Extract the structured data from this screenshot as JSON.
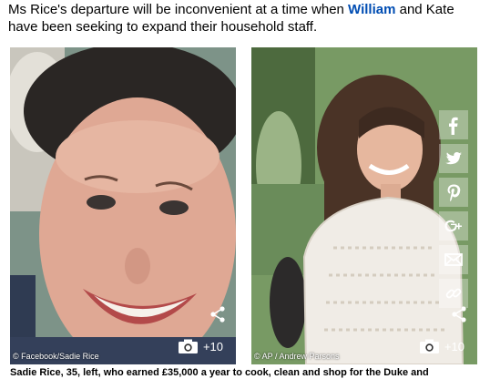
{
  "article": {
    "text_before": "Ms Rice's departure will be inconvenient at a time when ",
    "link_william": "William",
    "text_after": " and Kate have been seeking to expand their household staff."
  },
  "photos": [
    {
      "credit": "© Facebook/Sadie Rice",
      "gallery_count": "+10"
    },
    {
      "credit": "© AP / Andrew Parsons",
      "gallery_count": "+10"
    }
  ],
  "social_icons": [
    "facebook-icon",
    "twitter-icon",
    "pinterest-icon",
    "google-plus-icon",
    "email-icon",
    "link-icon"
  ],
  "caption": "Sadie Rice, 35, left, who earned £35,000 a year to cook, clean and shop for the Duke and",
  "colors": {
    "link": "#004db3",
    "badge_text": "#ffffff"
  }
}
